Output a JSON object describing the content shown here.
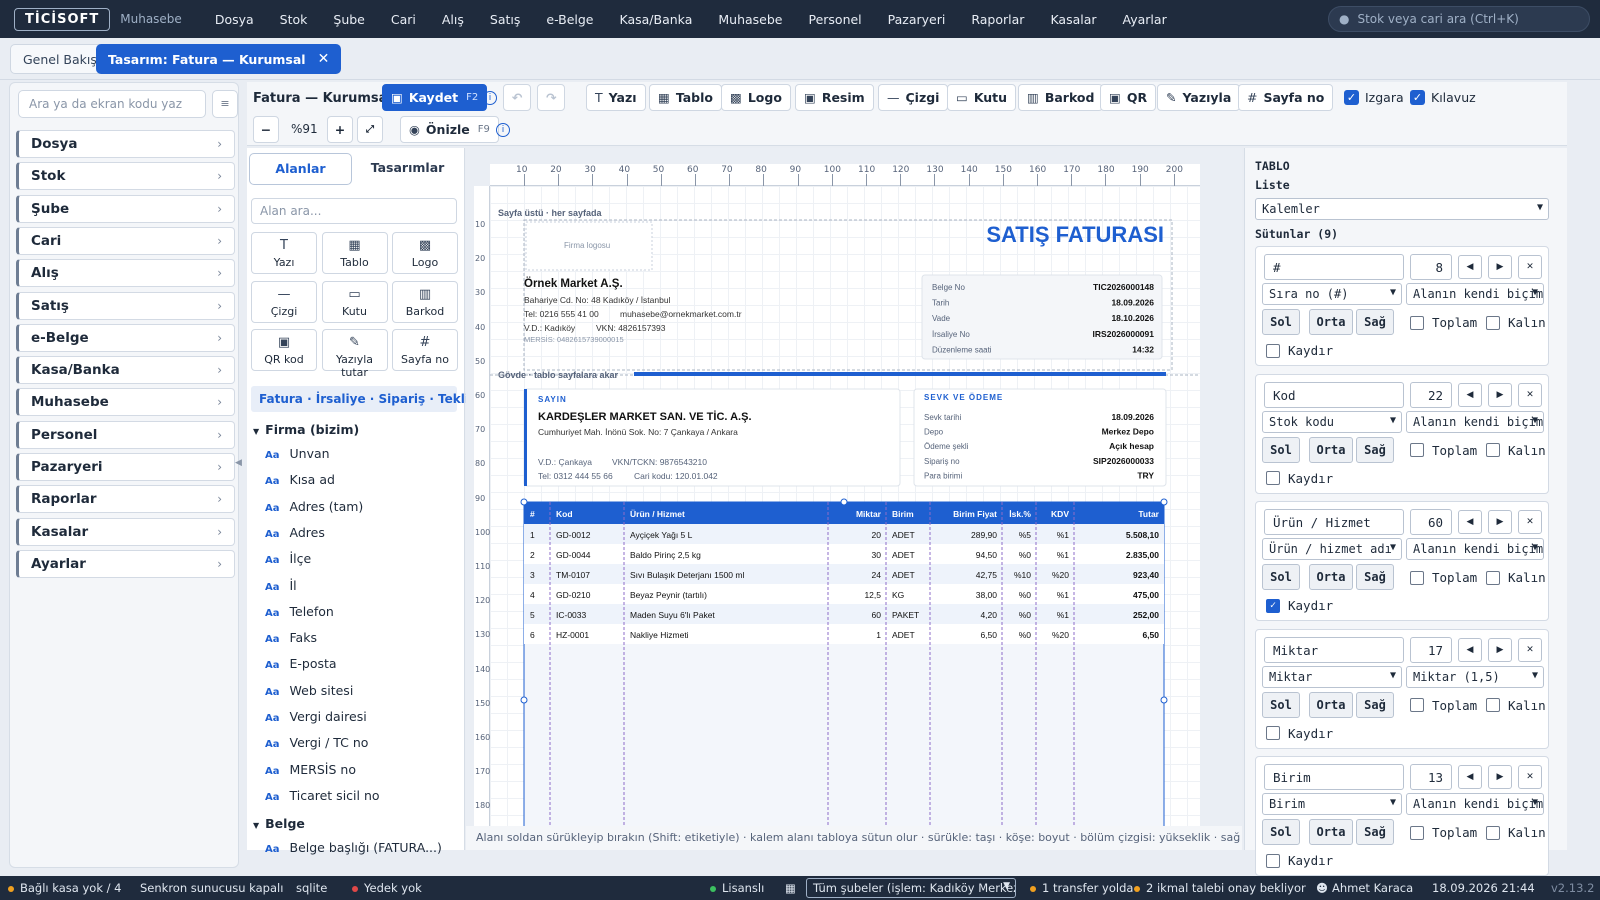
{
  "app": {
    "logo": "TİCİSOFT",
    "subtitle": "Muhasebe"
  },
  "menu": [
    "Dosya",
    "Stok",
    "Şube",
    "Cari",
    "Alış",
    "Satış",
    "e-Belge",
    "Kasa/Banka",
    "Muhasebe",
    "Personel",
    "Pazaryeri",
    "Raporlar",
    "Kasalar",
    "Ayarlar"
  ],
  "search": {
    "placeholder": "Stok veya cari ara (Ctrl+K)"
  },
  "tabs": {
    "overview": "Genel Bakış",
    "active": "Tasarım: Fatura — Kurumsal",
    "close": "✕"
  },
  "sidebar": {
    "search_placeholder": "Ara ya da ekran kodu yaz",
    "grid_btn": "≡",
    "items": [
      "Dosya",
      "Stok",
      "Şube",
      "Cari",
      "Alış",
      "Satış",
      "e-Belge",
      "Kasa/Banka",
      "Muhasebe",
      "Personel",
      "Pazaryeri",
      "Raporlar",
      "Kasalar",
      "Ayarlar"
    ]
  },
  "toolbar": {
    "doc_title": "Fatura — Kurumsal",
    "save": "Kaydet",
    "save_key": "F2",
    "zoom": "%91",
    "preview": "Önizle",
    "preview_key": "F9",
    "tools": [
      "Yazı",
      "Tablo",
      "Logo",
      "Resim",
      "Çizgi",
      "Kutu",
      "Barkod",
      "QR",
      "Yazıyla",
      "Sayfa no"
    ],
    "grid": "Izgara",
    "guide": "Kılavuz"
  },
  "fields": {
    "tab_fields": "Alanlar",
    "tab_designs": "Tasarımlar",
    "search_placeholder": "Alan ara...",
    "tools": [
      "Yazı",
      "Tablo",
      "Logo",
      "Çizgi",
      "Kutu",
      "Barkod",
      "QR kod",
      "Yazıyla tutar",
      "Sayfa no"
    ],
    "doc_types": "Fatura · İrsaliye · Sipariş · Teklif",
    "group1": "Firma (bizim)",
    "items": [
      "Unvan",
      "Kısa ad",
      "Adres (tam)",
      "Adres",
      "İlçe",
      "İl",
      "Telefon",
      "Faks",
      "E-posta",
      "Web sitesi",
      "Vergi dairesi",
      "Vergi / TC no",
      "MERSİS no",
      "Ticaret sicil no"
    ],
    "group2": "Belge",
    "group2_first": "Belge başlığı (FATURA...)"
  },
  "invoice": {
    "band_top": "Sayfa üstü · her sayfada",
    "logo_placeholder": "Firma logosu",
    "title": "SATIŞ FATURASI",
    "company": {
      "name": "Örnek Market A.Ş.",
      "address": "Bahariye Cd. No: 48 Kadıköy / İstanbul",
      "phone": "Tel: 0216 555 41 00",
      "email": "muhasebe@ornekmarket.com.tr",
      "tax_office": "V.D.: Kadıköy",
      "vkn": "VKN: 4826157393",
      "mersis": "MERSİS: 0482615739000015"
    },
    "meta": [
      [
        "Belge No",
        "TIC2026000148"
      ],
      [
        "Tarih",
        "18.09.2026"
      ],
      [
        "Vade",
        "18.10.2026"
      ],
      [
        "İrsaliye No",
        "IRS2026000091"
      ],
      [
        "Düzenleme saati",
        "14:32"
      ]
    ],
    "band_body": "Gövde · tablo sayfalara akar",
    "customer": {
      "label": "SAYIN",
      "name": "KARDEŞLER MARKET SAN. VE TİC. A.Ş.",
      "address": "Cumhuriyet Mah. İnönü Sok. No: 7 Çankaya / Ankara",
      "tax_office": "V.D.: Çankaya",
      "vkn": "VKN/TCKN: 9876543210",
      "phone": "Tel: 0312 444 55 66",
      "code": "Cari kodu: 120.01.042"
    },
    "shipping": {
      "label": "SEVK VE ÖDEME",
      "rows": [
        [
          "Sevk tarihi",
          "18.09.2026"
        ],
        [
          "Depo",
          "Merkez Depo"
        ],
        [
          "Ödeme şekli",
          "Açık hesap"
        ],
        [
          "Sipariş no",
          "SIP2026000033"
        ],
        [
          "Para birimi",
          "TRY"
        ]
      ]
    },
    "table": {
      "headers": [
        "#",
        "Kod",
        "Ürün / Hizmet",
        "Miktar",
        "Birim",
        "Birim Fiyat",
        "İsk.%",
        "KDV",
        "Tutar"
      ],
      "rows": [
        [
          "1",
          "GD-0012",
          "Ayçiçek Yağı 5 L",
          "20",
          "ADET",
          "289,90",
          "%5",
          "%1",
          "5.508,10"
        ],
        [
          "2",
          "GD-0044",
          "Baldo Pirinç 2,5 kg",
          "30",
          "ADET",
          "94,50",
          "%0",
          "%1",
          "2.835,00"
        ],
        [
          "3",
          "TM-0107",
          "Sıvı Bulaşık Deterjanı 1500 ml",
          "24",
          "ADET",
          "42,75",
          "%10",
          "%20",
          "923,40"
        ],
        [
          "4",
          "GD-0210",
          "Beyaz Peynir (tartılı)",
          "12,5",
          "KG",
          "38,00",
          "%0",
          "%1",
          "475,00"
        ],
        [
          "5",
          "IC-0033",
          "Maden Suyu 6'lı Paket",
          "60",
          "PAKET",
          "4,20",
          "%0",
          "%1",
          "252,00"
        ],
        [
          "6",
          "HZ-0001",
          "Nakliye Hizmeti",
          "1",
          "ADET",
          "6,50",
          "%0",
          "%20",
          "6,50"
        ]
      ]
    },
    "ruler_h": [
      "10",
      "20",
      "30",
      "40",
      "50",
      "60",
      "70",
      "80",
      "90",
      "100",
      "110",
      "120",
      "130",
      "140",
      "150",
      "160",
      "170",
      "180",
      "190",
      "200"
    ],
    "ruler_v": [
      "10",
      "20",
      "30",
      "40",
      "50",
      "60",
      "70",
      "80",
      "90",
      "100",
      "110",
      "120",
      "130",
      "140",
      "150",
      "160",
      "170",
      "180"
    ]
  },
  "hint": "Alanı soldan sürükleyip bırakın (Shift: etiketiyle) · kalem alanı tabloya sütun olur · sürükle: taşı · köşe: boyut · bölüm çizgisi: yükseklik · sağ tık: menü",
  "props": {
    "section": "TABLO",
    "list_label": "Liste",
    "list_value": "Kalemler",
    "columns_label": "Sütunlar (9)",
    "align": [
      "Sol",
      "Orta",
      "Sağ"
    ],
    "total": "Toplam",
    "bold": "Kalın",
    "wrap": "Kaydır",
    "remove": "✕",
    "left": "◀",
    "right": "▶",
    "columns": [
      {
        "title": "#",
        "width": "8",
        "source": "Sıra no (#)",
        "format": "Alanın kendi biçimi",
        "wrap": false
      },
      {
        "title": "Kod",
        "width": "22",
        "source": "Stok kodu",
        "format": "Alanın kendi biçimi",
        "wrap": false
      },
      {
        "title": "Ürün / Hizmet",
        "width": "60",
        "source": "Ürün / hizmet adı",
        "format": "Alanın kendi biçimi",
        "wrap": true
      },
      {
        "title": "Miktar",
        "width": "17",
        "source": "Miktar",
        "format": "Miktar (1,5)",
        "wrap": false
      },
      {
        "title": "Birim",
        "width": "13",
        "source": "Birim",
        "format": "Alanın kendi biçimi",
        "wrap": false
      }
    ]
  },
  "status": {
    "cash": "Bağlı kasa yok / 4",
    "sync": "Senkron sunucusu kapalı",
    "db": "sqlite",
    "backup": "Yedek yok",
    "license": "Lisanslı",
    "branch": "Tüm şubeler (işlem: Kadıköy Merkez)",
    "transfer": "1 transfer yolda",
    "restock": "2 ikmal talebi onay bekliyor",
    "user": "Ahmet Karaca",
    "datetime": "18.09.2026 21:44",
    "version": "v2.13.2"
  }
}
